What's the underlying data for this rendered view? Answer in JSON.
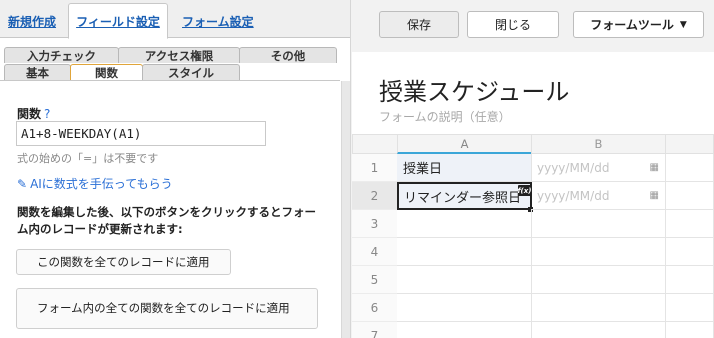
{
  "left_panel": {
    "top_tabs": [
      {
        "label": "新規作成",
        "active": false
      },
      {
        "label": "フィールド設定",
        "active": true
      },
      {
        "label": "フォーム設定",
        "active": false
      }
    ],
    "sub_tabs_row1": [
      {
        "label": "入力チェック"
      },
      {
        "label": "アクセス権限"
      },
      {
        "label": "その他"
      }
    ],
    "sub_tabs_row2": [
      {
        "label": "基本",
        "active": false
      },
      {
        "label": "関数",
        "active": true
      },
      {
        "label": "スタイル",
        "active": false
      }
    ],
    "function_label": "関数",
    "help_mark": "?",
    "formula_value": "A1+8-WEEKDAY(A1)",
    "formula_hint": "式の始めの「=」は不要です",
    "ai_link": "AIに数式を手伝ってもらう",
    "description": "関数を編集した後、以下のボタンをクリックするとフォーム内のレコードが更新されます:",
    "apply_button": "この関数を全てのレコードに適用",
    "apply_all_button": "フォーム内の全ての関数を全てのレコードに適用"
  },
  "right_panel": {
    "save_button": "保存",
    "close_button": "閉じる",
    "form_tools_button": "フォームツール",
    "form_title": "授業スケジュール",
    "form_description_placeholder": "フォームの説明（任意）",
    "columns": [
      "A",
      "B"
    ],
    "rows": [
      {
        "num": "1",
        "label": "授業日",
        "date_placeholder": "yyyy/MM/dd"
      },
      {
        "num": "2",
        "label": "リマインダー参照日",
        "date_placeholder": "yyyy/MM/dd"
      },
      {
        "num": "3"
      },
      {
        "num": "4"
      },
      {
        "num": "5"
      },
      {
        "num": "6"
      },
      {
        "num": "7"
      }
    ],
    "fx_badge": "f(x)"
  },
  "icons": {
    "pencil": "pencil-icon",
    "calendar": "calendar-icon",
    "dropdown": "chevron-down-icon"
  },
  "colors": {
    "link_blue": "#1a5fb4",
    "active_tab_border": "#e0a53a",
    "column_selected": "#3aa6d8",
    "label_cell_bg": "#eef2f8"
  }
}
